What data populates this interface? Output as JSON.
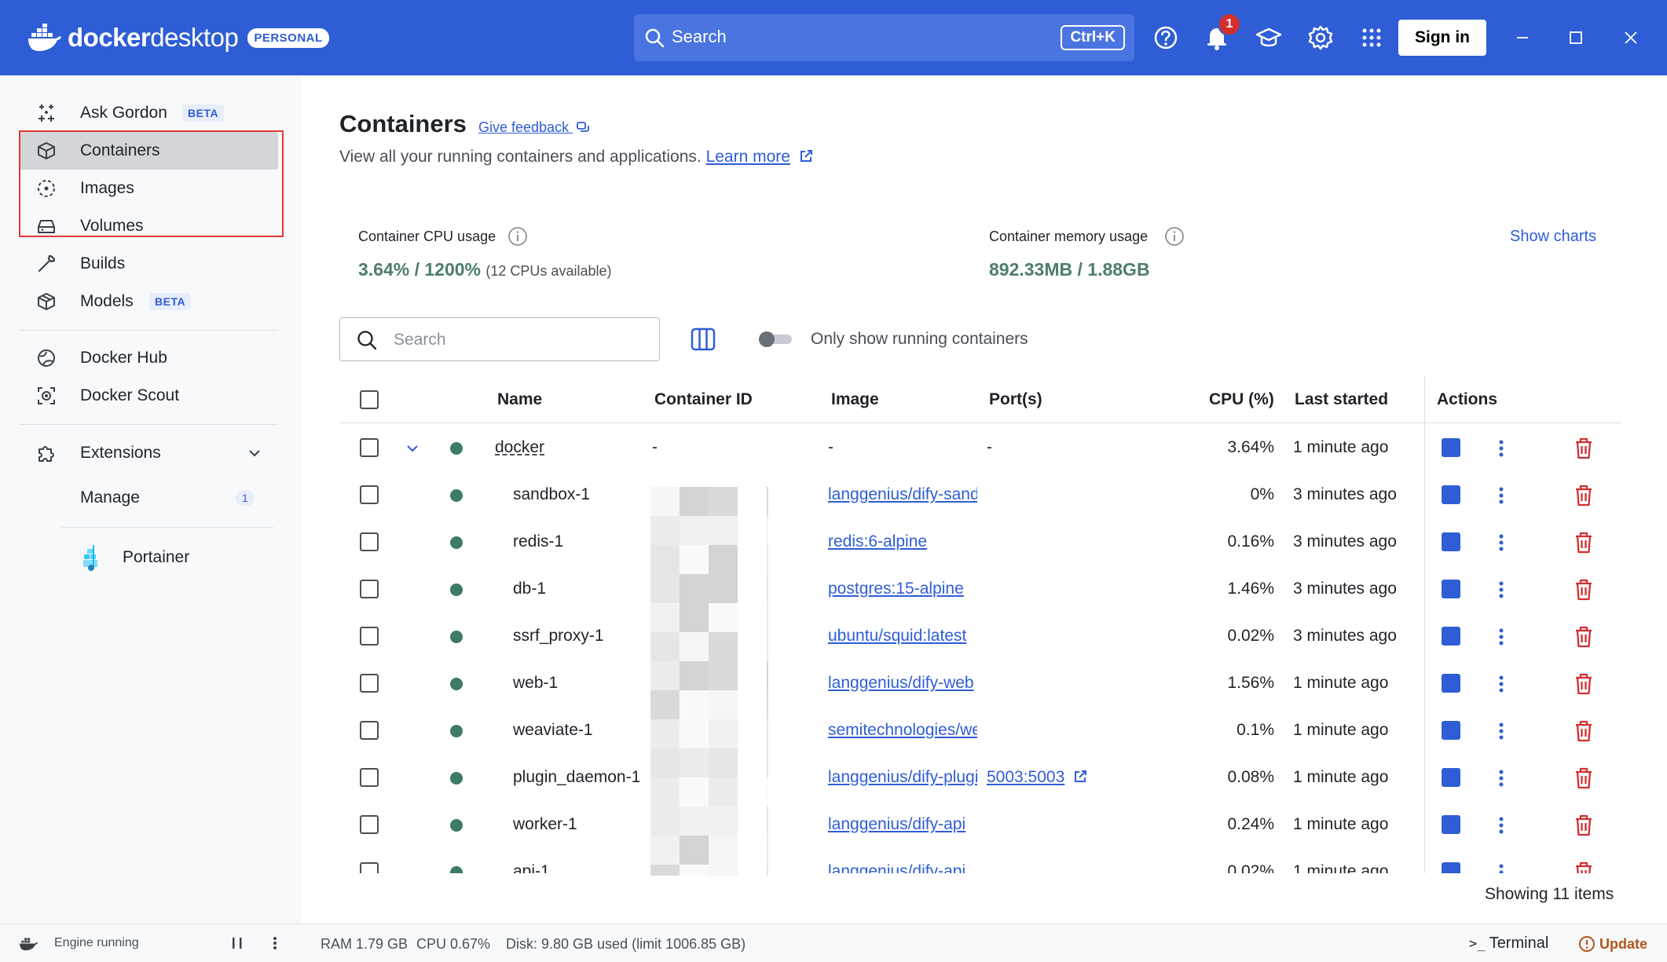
{
  "app": {
    "logo_text_bold": "docker",
    "logo_text_light": "desktop",
    "plan_badge": "PERSONAL",
    "search_label": "Search",
    "search_shortcut": "Ctrl+K",
    "notification_count": "1",
    "sign_in_label": "Sign in",
    "accent_color": "#2e5dd6"
  },
  "sidebar": {
    "items": [
      {
        "label": "Ask Gordon",
        "badge": "BETA",
        "icon": "sparkle-icon"
      },
      {
        "label": "Containers",
        "icon": "container-icon",
        "active": true
      },
      {
        "label": "Images",
        "icon": "image-icon"
      },
      {
        "label": "Volumes",
        "icon": "volume-icon"
      },
      {
        "label": "Builds",
        "icon": "wrench-icon"
      },
      {
        "label": "Models",
        "badge": "BETA",
        "icon": "cube-icon"
      },
      {
        "label": "Docker Hub",
        "icon": "hub-icon"
      },
      {
        "label": "Docker Scout",
        "icon": "scout-icon"
      },
      {
        "label": "Extensions",
        "icon": "puzzle-icon"
      },
      {
        "label": "Manage",
        "count": "1"
      },
      {
        "label": "Portainer",
        "icon": "portainer-icon"
      }
    ]
  },
  "main": {
    "title": "Containers",
    "feedback_link": "Give feedback",
    "subtitle": "View all your running containers and applications.",
    "learn_more": "Learn more",
    "cpu_label": "Container CPU usage",
    "cpu_value": "3.64% / 1200%",
    "cpu_note": "(12 CPUs available)",
    "mem_label": "Container memory usage",
    "mem_value": "892.33MB / 1.88GB",
    "show_charts": "Show charts",
    "search_placeholder": "Search",
    "toggle_label": "Only show running containers",
    "showing": "Showing 11 items"
  },
  "table": {
    "columns": [
      "Name",
      "Container ID",
      "Image",
      "Port(s)",
      "CPU (%)",
      "Last started",
      "Actions"
    ],
    "rows": [
      {
        "name": "docker",
        "id": "-",
        "image": "-",
        "port": "-",
        "cpu": "3.64%",
        "last": "1 minute ago",
        "group": true
      },
      {
        "name": "sandbox-1",
        "image": "langgenius/dify-sandbox",
        "port": "",
        "cpu": "0%",
        "last": "3 minutes ago"
      },
      {
        "name": "redis-1",
        "image": "redis:6-alpine",
        "port": "",
        "cpu": "0.16%",
        "last": "3 minutes ago"
      },
      {
        "name": "db-1",
        "image": "postgres:15-alpine",
        "port": "",
        "cpu": "1.46%",
        "last": "3 minutes ago"
      },
      {
        "name": "ssrf_proxy-1",
        "image": "ubuntu/squid:latest",
        "port": "",
        "cpu": "0.02%",
        "last": "3 minutes ago"
      },
      {
        "name": "web-1",
        "image": "langgenius/dify-web",
        "port": "",
        "cpu": "1.56%",
        "last": "1 minute ago"
      },
      {
        "name": "weaviate-1",
        "image": "semitechnologies/weaviate",
        "port": "",
        "cpu": "0.1%",
        "last": "1 minute ago"
      },
      {
        "name": "plugin_daemon-1",
        "image": "langgenius/dify-plugin-daemon",
        "port": "5003:5003",
        "cpu": "0.08%",
        "last": "1 minute ago"
      },
      {
        "name": "worker-1",
        "image": "langgenius/dify-api",
        "port": "",
        "cpu": "0.24%",
        "last": "1 minute ago"
      },
      {
        "name": "api-1",
        "image": "langgenius/dify-api",
        "port": "",
        "cpu": "0.02%",
        "last": "1 minute ago"
      }
    ]
  },
  "footer": {
    "engine_status": "Engine running",
    "ram": "RAM 1.79 GB",
    "cpu": "CPU 0.67%",
    "disk": "Disk: 9.80 GB used (limit 1006.85 GB)",
    "terminal": "Terminal",
    "update": "Update"
  }
}
